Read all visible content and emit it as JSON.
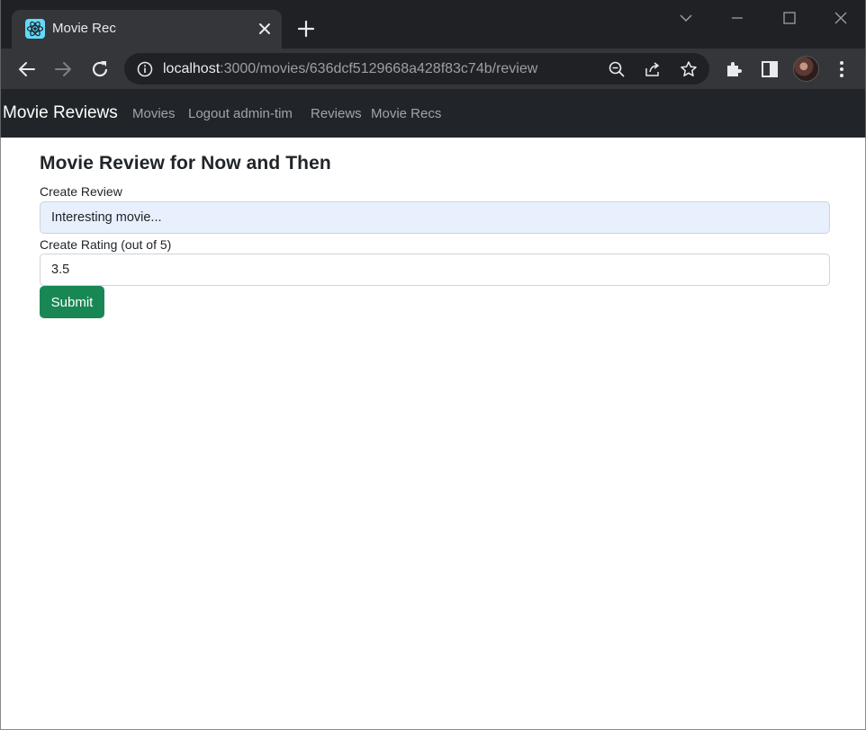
{
  "browser": {
    "tab_title": "Movie Rec",
    "url_host": "localhost",
    "url_rest": ":3000/movies/636dcf5129668a428f83c74b/review"
  },
  "navbar": {
    "brand": "Movie Reviews",
    "links": [
      "Movies",
      "Logout admin-tim",
      "Reviews",
      "Movie Recs"
    ]
  },
  "form": {
    "heading": "Movie Review for Now and Then",
    "review_label": "Create Review",
    "review_value": "Interesting movie...",
    "rating_label": "Create Rating (out of 5)",
    "rating_value": "3.5",
    "submit_label": "Submit"
  },
  "colors": {
    "navbar_bg": "#212529",
    "submit_bg": "#198754",
    "autofill_bg": "#e8f0fe"
  }
}
